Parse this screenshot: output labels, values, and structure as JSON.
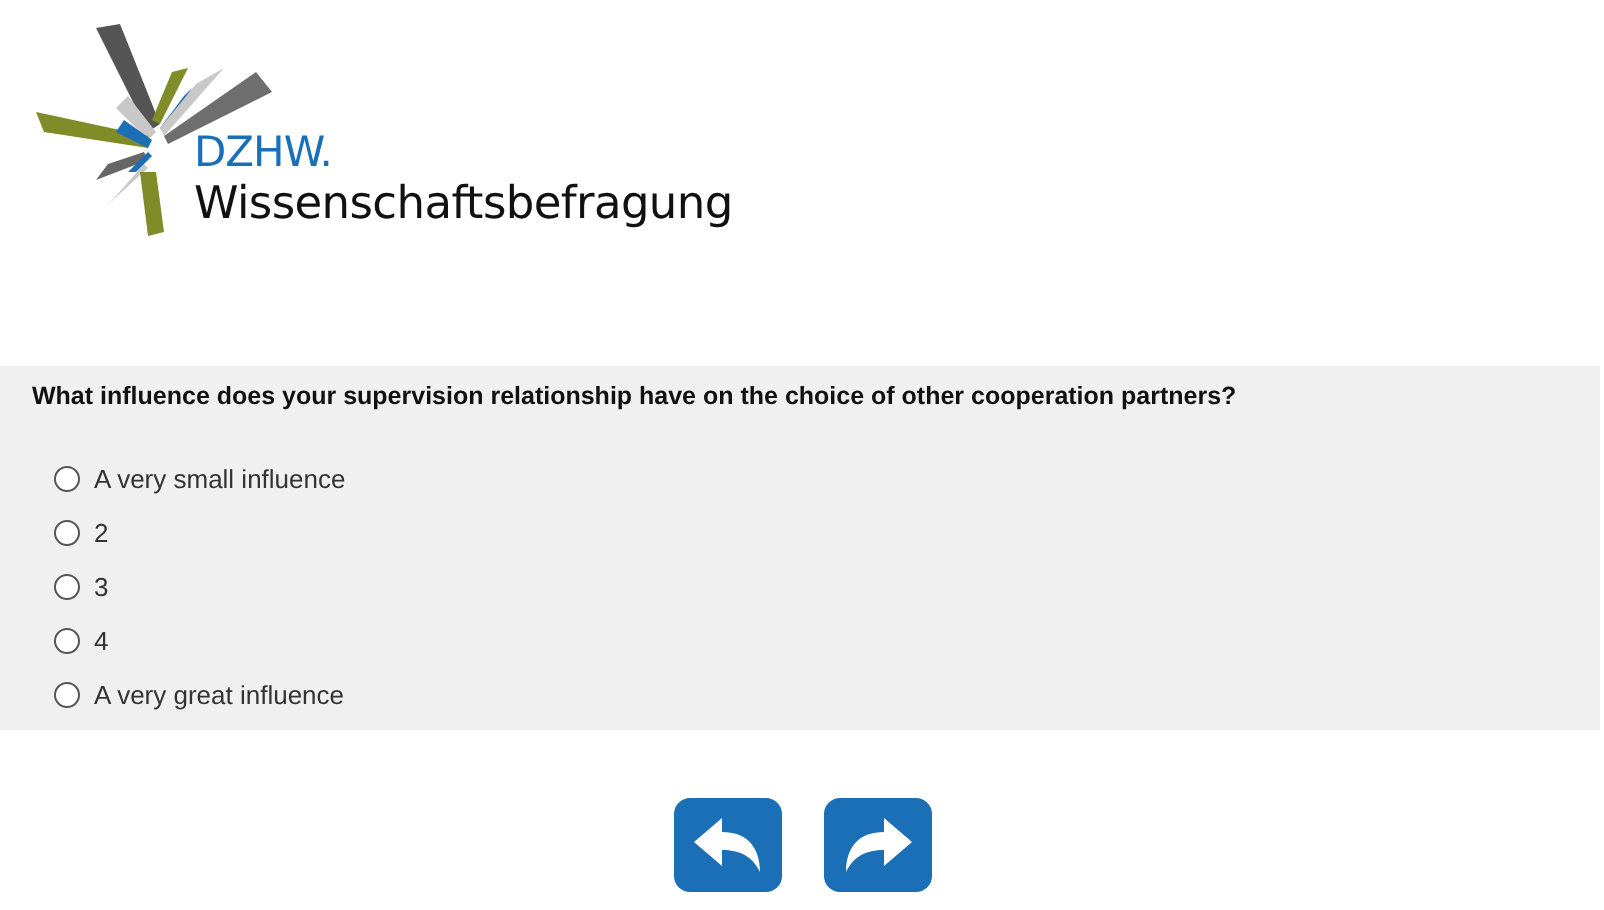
{
  "logo": {
    "brand": "DZHW.",
    "title": "Wissenschaftsbefragung"
  },
  "question": {
    "text": "What influence does your supervision relationship have on the choice of other cooperation partners?",
    "options": [
      {
        "label": "A very small influence",
        "selected": false
      },
      {
        "label": "2",
        "selected": false
      },
      {
        "label": "3",
        "selected": false
      },
      {
        "label": "4",
        "selected": false
      },
      {
        "label": "A very great influence",
        "selected": false
      }
    ]
  },
  "navigation": [
    {
      "kind": "back"
    },
    {
      "kind": "next"
    }
  ]
}
